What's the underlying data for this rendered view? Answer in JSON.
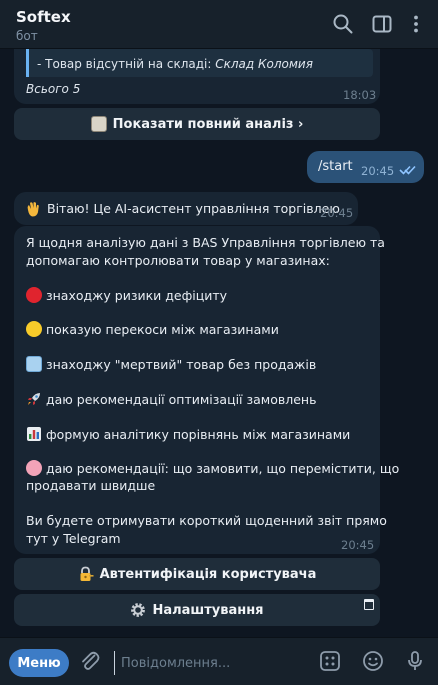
{
  "header": {
    "title": "Softex",
    "subtitle": "бот"
  },
  "messages": {
    "analysis_tail": {
      "quote_line": "- Товар відсутній на складі: ",
      "quote_store": "Склад Коломия",
      "total": "Всього 5",
      "time": "18:03"
    },
    "analysis_button": "Показати повний аналіз ›",
    "outgoing": {
      "text": "/start",
      "time": "20:45"
    },
    "greeting": {
      "text": "Вітаю! Це AI-асистент управління торгівлею",
      "time": "20:45"
    },
    "intro": {
      "line1": "Я щодня аналізую дані з BAS Управління торгівлею та",
      "line2": "допомагаю контролювати товар у магазинах:",
      "item1": "знаходжу ризики дефіциту",
      "item2": "показую перекоси між магазинами",
      "item3": "знаходжу \"мертвий\" товар без продажів",
      "item4": "даю рекомендації оптимізації замовлень",
      "item5": "формую аналітику порівнянь між магазинами",
      "item6a": "даю рекомендації: що замовити, що перемістити, що",
      "item6b": "продавати швидше",
      "outro1": "Ви будете отримувати короткий щоденний звіт прямо",
      "outro2": "тут у Telegram",
      "time": "20:45"
    },
    "auth_button": "Автентифікація користувача",
    "settings_button": "Налаштування"
  },
  "composer": {
    "menu_label": "Меню",
    "placeholder": "Повідомлення..."
  },
  "colors": {
    "background": "#0e1621",
    "bubble_in": "#182533",
    "bubble_out": "#2b5278",
    "accent": "#3d7cc6",
    "header": "#17212b"
  },
  "icons": {
    "header": [
      "search-icon",
      "sidebar-toggle-icon",
      "more-vert-icon"
    ],
    "composer": [
      "attach-icon",
      "commands-icon",
      "emoji-icon",
      "mic-icon"
    ],
    "emoji": [
      "waving-hand",
      "clipboard",
      "red-circle",
      "yellow-circle",
      "ice-cube",
      "rocket",
      "bar-chart",
      "brain",
      "locked-with-key",
      "gear"
    ]
  }
}
